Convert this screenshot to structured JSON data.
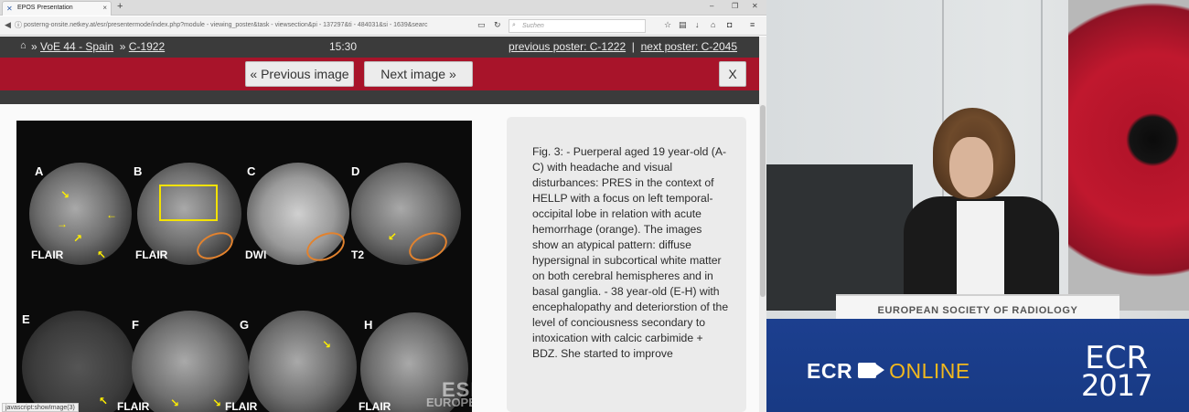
{
  "browser": {
    "tab_title": "EPOS Presentation",
    "url": "posterng-onsite.netkey.at/esr/presentermode/index.php?module - viewing_poster&task - viewsection&pi - 137297&ti - 484031&si - 1639&searc",
    "search_placeholder": "Suchen",
    "status_text": "javascript:showImage(3)"
  },
  "nav": {
    "breadcrumb_session": "VoE 44 - Spain",
    "breadcrumb_poster": "C-1922",
    "breadcrumb_sep1": "»",
    "breadcrumb_sep2": "»",
    "clock": "15:30",
    "previous_poster": "previous poster: C-1222",
    "separator": "|",
    "next_poster": "next poster: C-2045"
  },
  "controls": {
    "prev_image": "« Previous image",
    "next_image": "Next image »",
    "close": "X"
  },
  "figure": {
    "panels": [
      {
        "label": "A",
        "sequence": "FLAIR"
      },
      {
        "label": "B",
        "sequence": "FLAIR"
      },
      {
        "label": "C",
        "sequence": "DWI"
      },
      {
        "label": "D",
        "sequence": "T2"
      },
      {
        "label": "E",
        "sequence": ""
      },
      {
        "label": "F",
        "sequence": "FLAIR"
      },
      {
        "label": "G",
        "sequence": "FLAIR"
      },
      {
        "label": "H",
        "sequence": "FLAIR"
      }
    ],
    "watermark_line1": "ESR",
    "watermark_line2": "EUROPEAN SOCI"
  },
  "caption": {
    "text": "Fig. 3: - Puerperal aged 19 year-old (A-C) with headache and visual disturbances: PRES in the context of HELLP with a focus on left temporal-occipital lobe in relation with acute hemorrhage (orange). The images show an atypical pattern: diffuse hypersignal in subcortical white matter on both cerebral hemispheres and in basal ganglia. - 38 year-old (E-H) with encephalopathy and deteriorstion of the level of conciousness secondary to intoxication with calcic carbimide + BDZ. She started to improve"
  },
  "video": {
    "podium": "EUROPEAN SOCIETY OF RADIOLOGY",
    "online_left": "ECR",
    "online_right": "ONLINE",
    "logo_top": "ECR",
    "logo_year": "2017"
  },
  "colors": {
    "red_bar": "#a8142a",
    "nav_dark": "#3b3b3b",
    "annotation_yellow": "#ffee00",
    "hemorrhage_orange": "#e2822e",
    "banner_blue": "#1c3f8f",
    "online_gold": "#f1b81e"
  }
}
